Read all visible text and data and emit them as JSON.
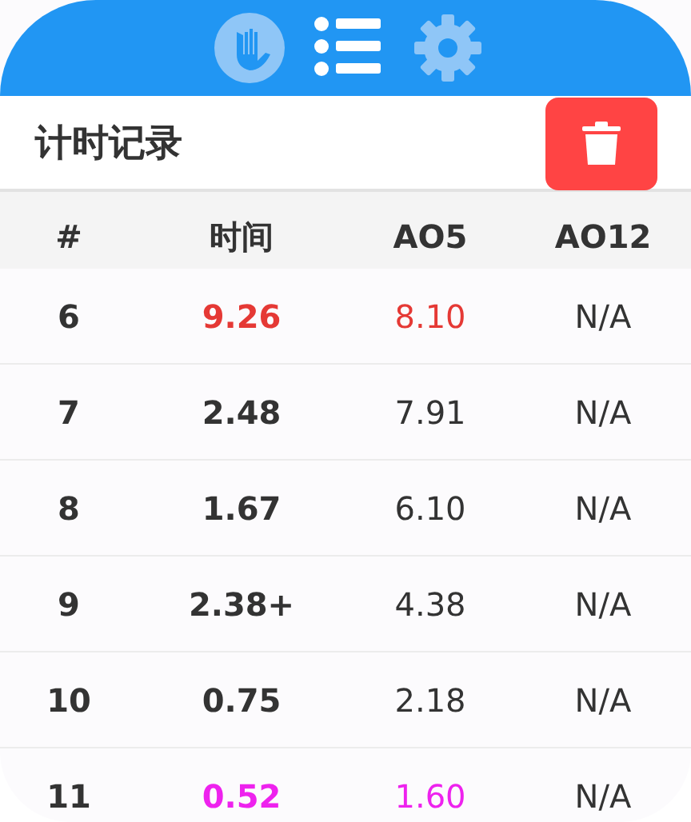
{
  "tabs": [
    {
      "kind": "hand",
      "selected": false
    },
    {
      "kind": "list",
      "selected": true
    },
    {
      "kind": "settings",
      "selected": false
    }
  ],
  "title": "计时记录",
  "table": {
    "columns": [
      "#",
      "时间",
      "AO5",
      "AO12"
    ],
    "rows": [
      {
        "cells": [
          "6",
          "9.26",
          "8.10",
          "N/A"
        ],
        "color": "#e53935"
      },
      {
        "cells": [
          "7",
          "2.48",
          "7.91",
          "N/A"
        ]
      },
      {
        "cells": [
          "8",
          "1.67",
          "6.10",
          "N/A"
        ]
      },
      {
        "cells": [
          "9",
          "2.38+",
          "4.38",
          "N/A"
        ]
      },
      {
        "cells": [
          "10",
          "0.75",
          "2.18",
          "N/A"
        ]
      },
      {
        "cells": [
          "11",
          "0.52",
          "1.60",
          "N/A"
        ],
        "color": "#ee22ee"
      }
    ]
  }
}
